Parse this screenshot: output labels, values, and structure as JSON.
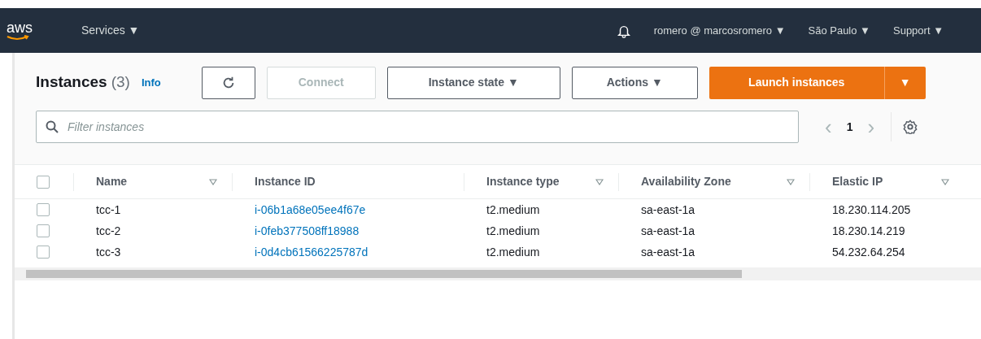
{
  "nav": {
    "logo": "aws",
    "services": "Services ▼",
    "user": "romero @ marcosromero ▼",
    "region": "São Paulo ▼",
    "support": "Support ▼"
  },
  "header": {
    "title": "Instances",
    "count": "(3)",
    "info": "Info",
    "connect": {
      "label": "Connect",
      "disabled": true
    },
    "instance_state": "Instance state ▼",
    "actions": "Actions ▼",
    "launch": "Launch instances",
    "launch_caret": "▼"
  },
  "filter": {
    "placeholder": "Filter instances"
  },
  "pagination": {
    "prev": "‹",
    "page": "1",
    "next": "›"
  },
  "table": {
    "select_all": {
      "checked": false
    },
    "columns": [
      {
        "label": "Name",
        "sortable": true
      },
      {
        "label": "Instance ID",
        "sortable": false
      },
      {
        "label": "Instance type",
        "sortable": true
      },
      {
        "label": "Availability Zone",
        "sortable": true
      },
      {
        "label": "Elastic IP",
        "sortable": true
      }
    ],
    "rows": [
      {
        "checked": false,
        "name": "tcc-1",
        "id": "i-06b1a68e05ee4f67e",
        "type": "t2.medium",
        "zone": "sa-east-1a",
        "ip": "18.230.114.205"
      },
      {
        "checked": false,
        "name": "tcc-2",
        "id": "i-0feb377508ff18988",
        "type": "t2.medium",
        "zone": "sa-east-1a",
        "ip": "18.230.14.219"
      },
      {
        "checked": false,
        "name": "tcc-3",
        "id": "i-0d4cb61566225787d",
        "type": "t2.medium",
        "zone": "sa-east-1a",
        "ip": "54.232.64.254"
      }
    ]
  }
}
